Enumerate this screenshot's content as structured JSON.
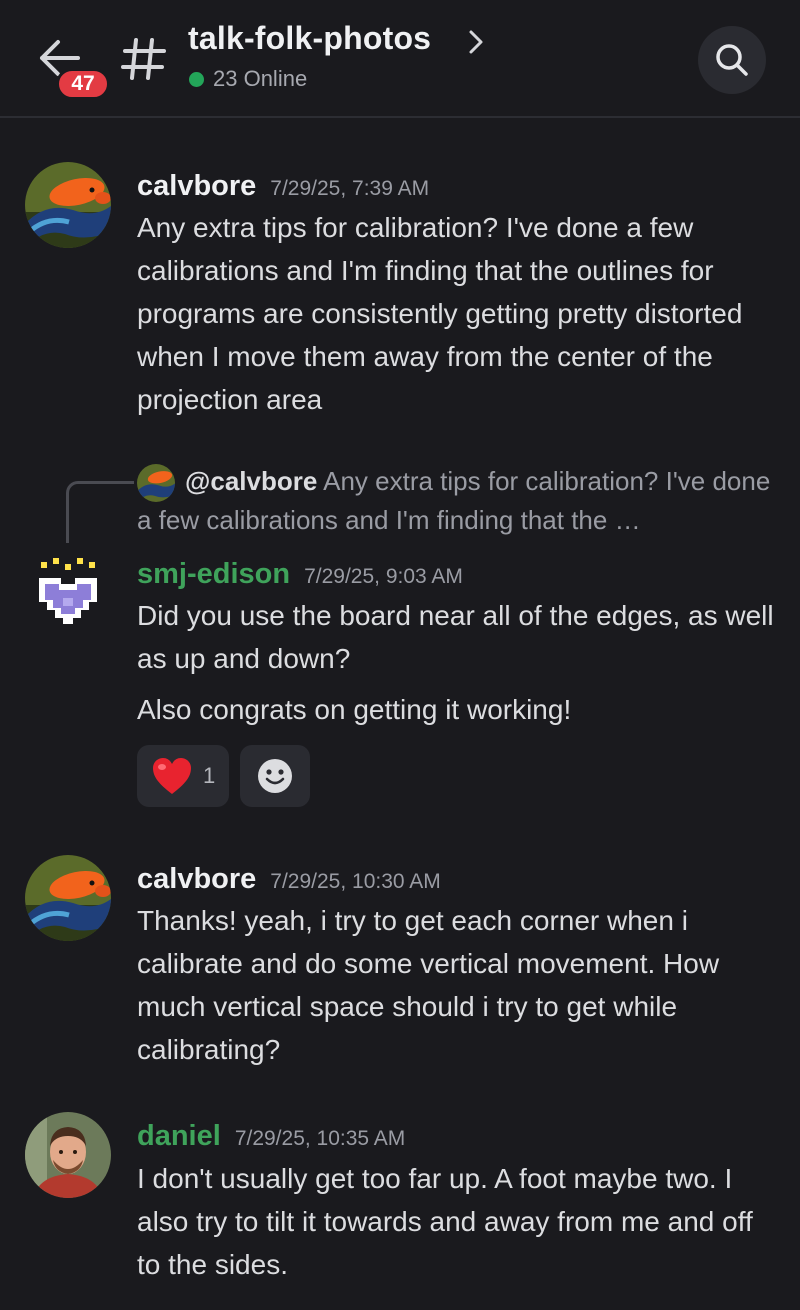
{
  "header": {
    "badge_count": "47",
    "channel_name": "talk-folk-photos",
    "online_status": "23 Online"
  },
  "colors": {
    "background": "#1a1a1e",
    "badge": "#e33b43",
    "online": "#23a559",
    "green_author": "#3fa35b"
  },
  "messages": [
    {
      "author": "calvbore",
      "timestamp": "7/29/25, 7:39 AM",
      "text": "Any extra tips for calibration?  I've done a few calibrations and I'm finding that the outlines for programs are consistently getting pretty distorted when I move them away from the center of the projection area"
    },
    {
      "reply_mention": "@calvbore",
      "reply_preview": "Any extra tips for calibration?  I've done a few calibrations and I'm finding that the …",
      "author": "smj-edison",
      "timestamp": "7/29/25, 9:03 AM",
      "text": "Did you use the board near all of the edges, as well as up and down?",
      "text2": "Also congrats on getting it working!",
      "reaction_count": "1"
    },
    {
      "author": "calvbore",
      "timestamp": "7/29/25, 10:30 AM",
      "text": "Thanks! yeah, i try to get each corner when i calibrate and do some vertical movement. How much vertical space should i try to get while calibrating?"
    },
    {
      "author": "daniel",
      "timestamp": "7/29/25, 10:35 AM",
      "text": "I don't usually get too far up. A foot maybe two. I also try to tilt it towards and away from me and off to the sides."
    }
  ]
}
